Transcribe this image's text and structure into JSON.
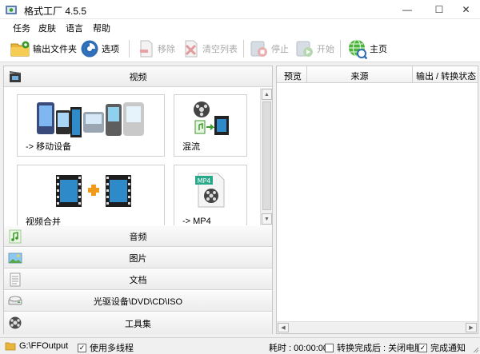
{
  "window": {
    "title": "格式工厂 4.5.5",
    "min_glyph": "—",
    "max_glyph": "☐",
    "close_glyph": "✕"
  },
  "menu": [
    {
      "label": "任务"
    },
    {
      "label": "皮肤"
    },
    {
      "label": "语言"
    },
    {
      "label": "帮助"
    }
  ],
  "toolbar": {
    "output_folder": "输出文件夹",
    "options": "选项",
    "remove": "移除",
    "clear_list": "清空列表",
    "stop": "停止",
    "start": "开始",
    "home": "主页"
  },
  "categories": {
    "video": "视频",
    "audio": "音频",
    "picture": "图片",
    "document": "文档",
    "disc": "光驱设备\\DVD\\CD\\ISO",
    "toolbox": "工具集"
  },
  "tiles": [
    {
      "label": "-> 移动设备",
      "icon": "mobile-devices-icon"
    },
    {
      "label": "混流",
      "icon": "mux-icon"
    },
    {
      "label": "视频合并",
      "icon": "video-join-icon"
    },
    {
      "label": "-> MP4",
      "icon": "mp4-file-icon",
      "badge": "MP4"
    }
  ],
  "task_table": {
    "columns": [
      "预览",
      "来源",
      "输出 / 转换状态"
    ]
  },
  "status": {
    "output_path": "G:\\FFOutput",
    "multithread": "使用多线程",
    "elapsed": "耗时 : 00:00:00",
    "after_convert": "转换完成后 : 关闭电脑",
    "notify": "完成通知",
    "check_glyph": "✓"
  },
  "colors": {
    "accent_green": "#3a9a2a",
    "film_blue": "#2e8ac8",
    "plus_orange": "#f19a1a"
  }
}
